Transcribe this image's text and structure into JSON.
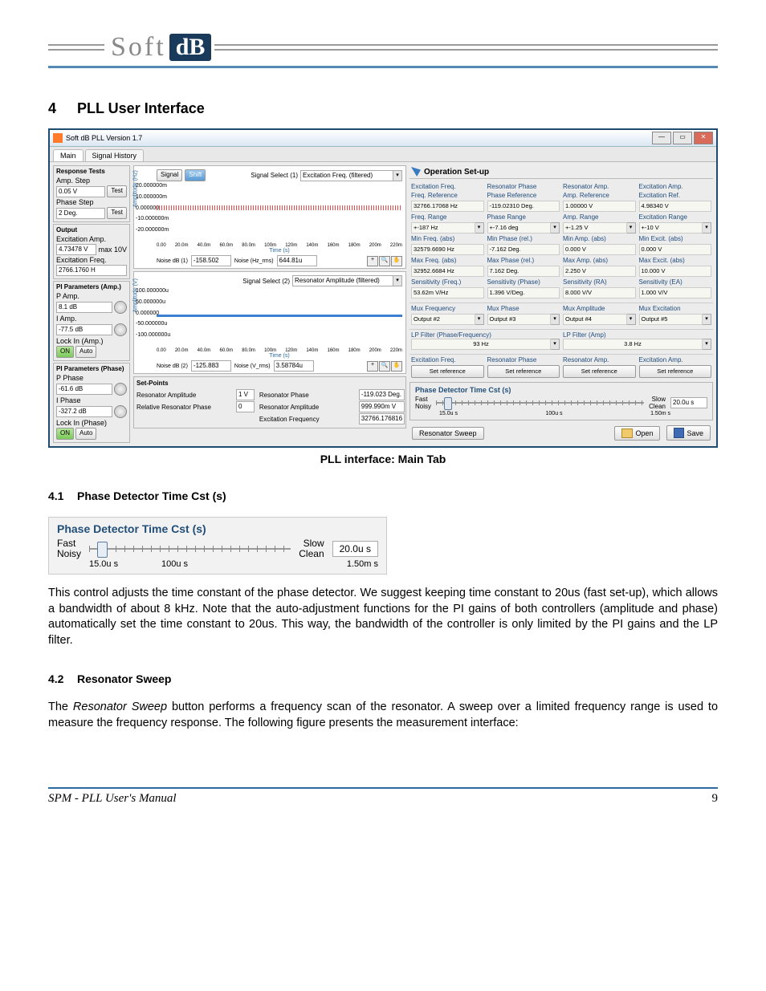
{
  "logo": {
    "soft": "Soft",
    "db": "dB"
  },
  "sections": {
    "s4_num": "4",
    "s4": "PLL User Interface",
    "s41_num": "4.1",
    "s41": "Phase Detector Time Cst (s)",
    "s42_num": "4.2",
    "s42": "Resonator Sweep"
  },
  "window": {
    "title": "Soft dB PLL Version 1.7",
    "tabs": {
      "main": "Main",
      "hist": "Signal History"
    }
  },
  "left": {
    "response_tests": "Response Tests",
    "amp_step": "Amp. Step",
    "amp_step_val": "0.05 V",
    "btn_test": "Test",
    "phase_step": "Phase Step",
    "phase_step_val": "2 Deg.",
    "output": "Output",
    "exc_amp": "Excitation Amp.",
    "exc_amp_val": "4.73478 V",
    "exc_amp_max": "max 10V",
    "exc_freq": "Excitation Freq.",
    "exc_freq_val": "2766.1760 H",
    "pi_amp": "PI Parameters (Amp.)",
    "p_amp": "P Amp.",
    "p_amp_val": "8.1 dB",
    "i_amp": "I Amp.",
    "i_amp_val": "-77.5 dB",
    "lock_amp": "Lock In (Amp.)",
    "on": "ON",
    "auto": "Auto",
    "pi_phase": "PI Parameters (Phase)",
    "p_phase": "P Phase",
    "p_phase_val": "-61.6 dB",
    "i_phase": "I Phase",
    "i_phase_val": "-327.2 dB",
    "lock_phase": "Lock In (Phase)"
  },
  "plots": {
    "signal_btn": "Signal",
    "shift_btn": "Shift",
    "sel1": "Signal Select (1)",
    "sel1_val": "Excitation Freq. (filtered)",
    "y1": [
      "20.000000m",
      "10.000000m",
      "0.000000",
      "-10.000000m",
      "-20.000000m"
    ],
    "ylabel": "Amplitude (Hz)",
    "x": [
      "0.00",
      "20.0m",
      "40.0m",
      "60.0m",
      "80.0m",
      "100m",
      "120m",
      "140m",
      "160m",
      "180m",
      "200m",
      "220m"
    ],
    "xlabel": "Time (s)",
    "noise_db1_lbl": "Noise dB (1)",
    "noise_db1": "-158.502",
    "noise_hz_lbl": "Noise (Hz_rms)",
    "noise_hz": "644.81u",
    "sel2": "Signal Select (2)",
    "sel2_val": "Resonator Amplitude (filtered)",
    "y2": [
      "100.000000u",
      "50.000000u",
      "0.000000",
      "-50.000000u",
      "-100.000000u"
    ],
    "ylabel2": "Amplitude (V)",
    "noise_db2_lbl": "Noise dB (2)",
    "noise_db2": "-125.883",
    "noise_v_lbl": "Noise (V_rms)",
    "noise_v": "3.58784u",
    "setpoints": "Set-Points",
    "res_amp_lbl": "Resonator Amplitude",
    "res_amp_sp": "1 V",
    "rel_phase_lbl": "Relative Resonator Phase",
    "rel_phase_sp": "0 Deg.",
    "res_phase_lbl": "Resonator Phase",
    "res_phase": "-119.023 Deg.",
    "res_amp2_lbl": "Resonator Amplitude",
    "res_amp2": "999.990m V",
    "exc_freq_lbl": "Excitation Frequency",
    "exc_freq": "32766.176816 Hz"
  },
  "op": {
    "title": "Operation Set-up",
    "h": [
      "Excitation Freq.",
      "Resonator Phase",
      "Resonator Amp.",
      "Excitation Amp."
    ],
    "r1h": [
      "Freq. Reference",
      "Phase Reference",
      "Amp. Reference",
      "Excitation Ref."
    ],
    "r1": [
      "32766.17068 Hz",
      "-119.02310 Deg.",
      "1.00000 V",
      "4.98340 V"
    ],
    "r2h": [
      "Freq. Range",
      "Phase Range",
      "Amp. Range",
      "Excitation Range"
    ],
    "r2": [
      "+-187 Hz",
      "+-7.16 deg",
      "+-1.25 V",
      "+-10 V"
    ],
    "r3h": [
      "Min Freq. (abs)",
      "Min Phase (rel.)",
      "Min Amp. (abs)",
      "Min Excit. (abs)"
    ],
    "r3": [
      "32579.6690 Hz",
      "-7.162 Deg.",
      "0.000 V",
      "0.000 V"
    ],
    "r4h": [
      "Max Freq. (abs)",
      "Max Phase (rel.)",
      "Max Amp. (abs)",
      "Max Excit. (abs)"
    ],
    "r4": [
      "32952.6684 Hz",
      "7.162 Deg.",
      "2.250 V",
      "10.000 V"
    ],
    "r5h": [
      "Sensitivity (Freq.)",
      "Sensitivity (Phase)",
      "Sensitivity (RA)",
      "Sensitivity (EA)"
    ],
    "r5": [
      "53.62m V/Hz",
      "1.396 V/Deg.",
      "8.000 V/V",
      "1.000 V/V"
    ],
    "mux_h": [
      "Mux Frequency",
      "Mux Phase",
      "Mux Amplitude",
      "Mux Excitation"
    ],
    "mux": [
      "Output #2",
      "Output #3",
      "Output #4",
      "Output #5"
    ],
    "lp1": "LP Filter (Phase/Frequency)",
    "lp1_val": "93 Hz",
    "lp2": "LP Filter (Amp)",
    "lp2_val": "3.8 Hz",
    "ref_h": [
      "Excitation Freq.",
      "Resonator Phase",
      "Resonator Amp.",
      "Excitation Amp."
    ],
    "ref_btn": "Set reference",
    "pd_title": "Phase Detector Time Cst (s)",
    "fast": "Fast",
    "noisy": "Noisy",
    "slow": "Slow",
    "clean": "Clean",
    "pd_val": "20.0u s",
    "pd_t": [
      "15.0u s",
      "100u s",
      "1.50m s"
    ],
    "sweep": "Resonator Sweep",
    "open": "Open",
    "save": "Save"
  },
  "caption": "PLL interface: Main Tab",
  "zoom": {
    "title": "Phase Detector Time Cst (s)",
    "fast": "Fast",
    "noisy": "Noisy",
    "slow": "Slow",
    "clean": "Clean",
    "val": "20.0u s",
    "t": [
      "15.0u s",
      "100u s",
      "1.50m s"
    ]
  },
  "para1": "This control adjusts the time constant of the phase detector. We suggest keeping time constant to 20us (fast set-up), which allows a bandwidth of about 8 kHz. Note that the auto-adjustment functions for the PI gains of both controllers (amplitude and phase) automatically set the time constant to 20us. This way, the bandwidth of the controller is only limited by the PI gains and the LP filter.",
  "para2_a": "The ",
  "para2_i": "Resonator Sweep",
  "para2_b": " button performs a frequency scan of the resonator. A sweep over a limited frequency range is used to measure the frequency response. The following figure presents the measurement interface:",
  "footer": {
    "title": "SPM - PLL User's Manual",
    "page": "9"
  }
}
